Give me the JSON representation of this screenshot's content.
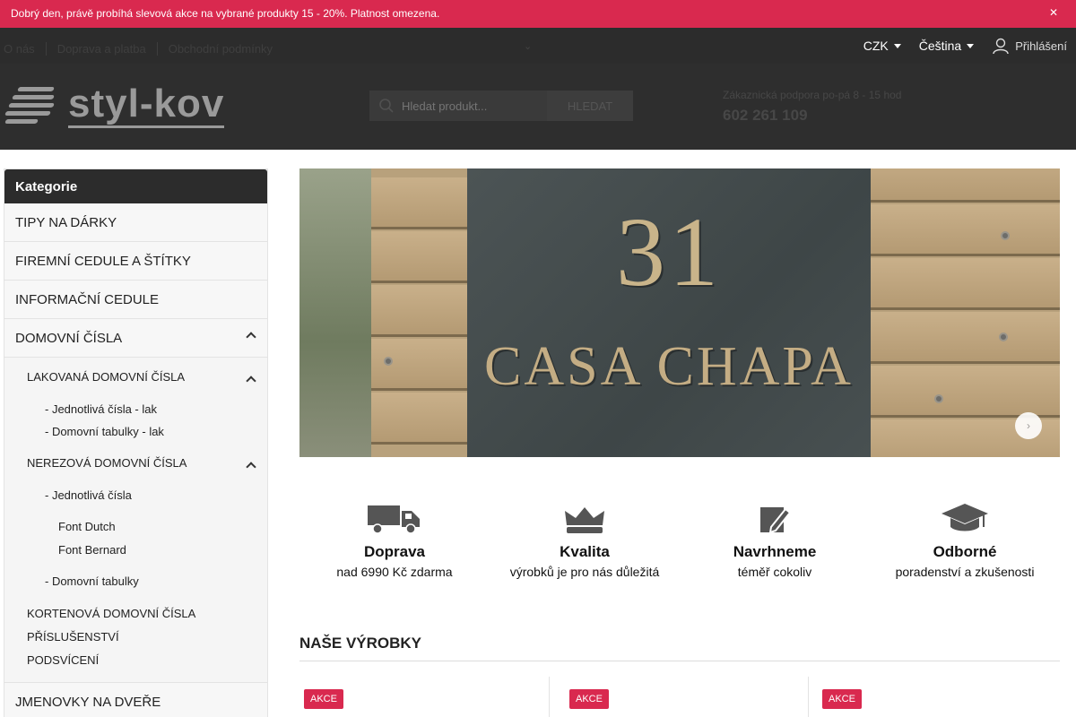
{
  "promo": {
    "text": "Dobrý den, právě probíhá slevová akce na vybrané produkty 15 - 20%. Platnost omezena.",
    "close_icon": "close-icon"
  },
  "nav": {
    "links": [
      "O nás",
      "Doprava a platba",
      "Obchodní podmínky"
    ],
    "currency": "CZK",
    "language": "Čeština",
    "login": "Přihlášení"
  },
  "header": {
    "logo_text": "styl-kov",
    "search_placeholder": "Hledat produkt...",
    "search_button": "HLEDAT",
    "support_hours": "Zákaznická podpora po-pá 8 - 15 hod",
    "support_phone": "602 261 109"
  },
  "sidebar": {
    "title": "Kategorie",
    "top_items": [
      "TIPY NA DÁRKY",
      "FIREMNÍ CEDULE A ŠTÍTKY",
      "INFORMAČNÍ CEDULE"
    ],
    "expanded": "DOMOVNÍ ČÍSLA",
    "lakovana": "LAKOVANÁ DOMOVNÍ ČÍSLA",
    "lak_items": [
      "- Jednotlivá čísla - lak",
      "- Domovní tabulky - lak"
    ],
    "nerezova": "NEREZOVÁ DOMOVNÍ ČÍSLA",
    "nerez_jednotliva": "- Jednotlivá čísla",
    "fonts": [
      "Font Dutch",
      "Font Bernard"
    ],
    "nerez_tabulky": "- Domovní tabulky",
    "other_subs": [
      "KORTENOVÁ DOMOVNÍ ČÍSLA",
      "PŘÍSLUŠENSTVÍ",
      "PODSVÍCENÍ"
    ],
    "last_item": "JMENOVKY NA DVEŘE"
  },
  "banner": {
    "number": "31",
    "name": "CASA CHAPA"
  },
  "features": [
    {
      "icon": "truck-icon",
      "title": "Doprava",
      "subtitle": "nad 6990 Kč zdarma"
    },
    {
      "icon": "crown-icon",
      "title": "Kvalita",
      "subtitle": "výrobků je pro nás důležitá"
    },
    {
      "icon": "pencil-icon",
      "title": "Navrhneme",
      "subtitle": "téměř cokoliv"
    },
    {
      "icon": "graduation-cap-icon",
      "title": "Odborné",
      "subtitle": "poradenství a zkušenosti"
    }
  ],
  "products": {
    "title": "NAŠE VÝROBKY",
    "badge": "AKCE"
  },
  "colors": {
    "accent": "#d9294f",
    "dark": "#2c2c2c"
  }
}
